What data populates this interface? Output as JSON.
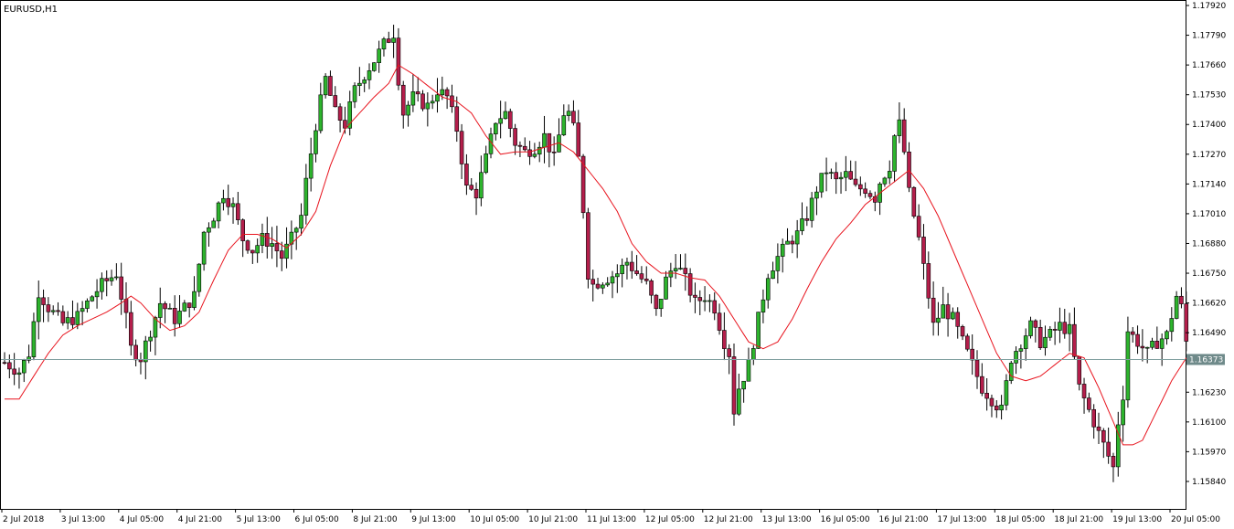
{
  "chart_data": {
    "type": "candlestick",
    "symbol": "EURUSD,H1",
    "y_ticks": [
      "1.17920",
      "1.17790",
      "1.17660",
      "1.17530",
      "1.17400",
      "1.17270",
      "1.17140",
      "1.17010",
      "1.16880",
      "1.16750",
      "1.16620",
      "1.16490",
      "1.16230",
      "1.16100",
      "1.15970",
      "1.15840"
    ],
    "ylim": [
      1.1572,
      1.1794
    ],
    "current_price": "1.16373",
    "current_price_value": 1.16373,
    "x_ticks": [
      "2 Jul 2018",
      "3 Jul 13:00",
      "4 Jul 05:00",
      "4 Jul 21:00",
      "5 Jul 13:00",
      "6 Jul 05:00",
      "8 Jul 21:00",
      "9 Jul 13:00",
      "10 Jul 05:00",
      "10 Jul 21:00",
      "11 Jul 13:00",
      "12 Jul 05:00",
      "12 Jul 21:00",
      "13 Jul 13:00",
      "16 Jul 05:00",
      "16 Jul 21:00",
      "17 Jul 13:00",
      "18 Jul 05:00",
      "18 Jul 21:00",
      "19 Jul 13:00",
      "20 Jul 05:00"
    ],
    "close_path": [
      [
        0,
        1.1636
      ],
      [
        3,
        1.1632
      ],
      [
        5,
        1.164
      ],
      [
        7,
        1.1667
      ],
      [
        9,
        1.166
      ],
      [
        12,
        1.1653
      ],
      [
        15,
        1.1656
      ],
      [
        18,
        1.1665
      ],
      [
        20,
        1.167
      ],
      [
        23,
        1.1675
      ],
      [
        25,
        1.1655
      ],
      [
        26,
        1.1642
      ],
      [
        28,
        1.1638
      ],
      [
        30,
        1.165
      ],
      [
        32,
        1.1662
      ],
      [
        35,
        1.1655
      ],
      [
        37,
        1.166
      ],
      [
        39,
        1.1665
      ],
      [
        41,
        1.1693
      ],
      [
        43,
        1.17
      ],
      [
        45,
        1.171
      ],
      [
        47,
        1.1704
      ],
      [
        49,
        1.169
      ],
      [
        51,
        1.1685
      ],
      [
        53,
        1.169
      ],
      [
        55,
        1.1688
      ],
      [
        57,
        1.1682
      ],
      [
        59,
        1.169
      ],
      [
        61,
        1.17
      ],
      [
        62,
        1.1715
      ],
      [
        64,
        1.174
      ],
      [
        66,
        1.176
      ],
      [
        68,
        1.1745
      ],
      [
        70,
        1.174
      ],
      [
        72,
        1.1755
      ],
      [
        74,
        1.1762
      ],
      [
        76,
        1.1768
      ],
      [
        78,
        1.1775
      ],
      [
        80,
        1.178
      ],
      [
        81,
        1.176
      ],
      [
        82,
        1.1745
      ],
      [
        84,
        1.1752
      ],
      [
        87,
        1.1748
      ],
      [
        89,
        1.1755
      ],
      [
        91,
        1.1752
      ],
      [
        93,
        1.1738
      ],
      [
        95,
        1.1712
      ],
      [
        97,
        1.171
      ],
      [
        99,
        1.1725
      ],
      [
        101,
        1.1742
      ],
      [
        103,
        1.1745
      ],
      [
        105,
        1.1732
      ],
      [
        107,
        1.1728
      ],
      [
        109,
        1.173
      ],
      [
        111,
        1.1735
      ],
      [
        113,
        1.1725
      ],
      [
        115,
        1.1745
      ],
      [
        116,
        1.1745
      ],
      [
        117,
        1.1738
      ],
      [
        118,
        1.1725
      ],
      [
        119,
        1.1703
      ],
      [
        120,
        1.1675
      ],
      [
        121,
        1.167
      ],
      [
        123,
        1.1672
      ],
      [
        126,
        1.1675
      ],
      [
        128,
        1.168
      ],
      [
        130,
        1.1675
      ],
      [
        132,
        1.167
      ],
      [
        134,
        1.1658
      ],
      [
        136,
        1.1672
      ],
      [
        138,
        1.168
      ],
      [
        140,
        1.1672
      ],
      [
        142,
        1.1662
      ],
      [
        144,
        1.1665
      ],
      [
        146,
        1.166
      ],
      [
        148,
        1.1645
      ],
      [
        149,
        1.164
      ],
      [
        150,
        1.1615
      ],
      [
        151,
        1.1625
      ],
      [
        153,
        1.1635
      ],
      [
        155,
        1.1655
      ],
      [
        157,
        1.1675
      ],
      [
        159,
        1.1682
      ],
      [
        161,
        1.1688
      ],
      [
        163,
        1.1692
      ],
      [
        165,
        1.17
      ],
      [
        167,
        1.1712
      ],
      [
        169,
        1.172
      ],
      [
        171,
        1.1715
      ],
      [
        173,
        1.1718
      ],
      [
        175,
        1.1712
      ],
      [
        177,
        1.1712
      ],
      [
        179,
        1.1708
      ],
      [
        180,
        1.1715
      ],
      [
        182,
        1.1722
      ],
      [
        183,
        1.1735
      ],
      [
        184,
        1.174
      ],
      [
        185,
        1.1728
      ],
      [
        186,
        1.171
      ],
      [
        188,
        1.169
      ],
      [
        190,
        1.1665
      ],
      [
        191,
        1.1652
      ],
      [
        193,
        1.166
      ],
      [
        195,
        1.1655
      ],
      [
        197,
        1.1645
      ],
      [
        199,
        1.1635
      ],
      [
        201,
        1.1625
      ],
      [
        203,
        1.162
      ],
      [
        205,
        1.1615
      ],
      [
        207,
        1.1638
      ],
      [
        209,
        1.1645
      ],
      [
        211,
        1.1652
      ],
      [
        213,
        1.1645
      ],
      [
        215,
        1.1648
      ],
      [
        217,
        1.1652
      ],
      [
        219,
        1.165
      ],
      [
        221,
        1.1625
      ],
      [
        223,
        1.1615
      ],
      [
        225,
        1.1605
      ],
      [
        227,
        1.1595
      ],
      [
        228,
        1.159
      ],
      [
        229,
        1.161
      ],
      [
        230,
        1.1622
      ],
      [
        231,
        1.165
      ],
      [
        233,
        1.1645
      ],
      [
        235,
        1.164
      ],
      [
        237,
        1.1645
      ],
      [
        239,
        1.1648
      ],
      [
        241,
        1.1665
      ],
      [
        242,
        1.166
      ],
      [
        243,
        1.1645
      ]
    ],
    "ma_path": [
      [
        0,
        1.162
      ],
      [
        3,
        1.162
      ],
      [
        6,
        1.163
      ],
      [
        9,
        1.164
      ],
      [
        12,
        1.1648
      ],
      [
        15,
        1.1652
      ],
      [
        18,
        1.1655
      ],
      [
        21,
        1.1658
      ],
      [
        24,
        1.1662
      ],
      [
        26,
        1.1665
      ],
      [
        28,
        1.1662
      ],
      [
        31,
        1.1655
      ],
      [
        34,
        1.165
      ],
      [
        37,
        1.1652
      ],
      [
        40,
        1.1658
      ],
      [
        43,
        1.1672
      ],
      [
        46,
        1.1685
      ],
      [
        49,
        1.1692
      ],
      [
        52,
        1.1692
      ],
      [
        55,
        1.169
      ],
      [
        58,
        1.1686
      ],
      [
        61,
        1.1692
      ],
      [
        64,
        1.1702
      ],
      [
        67,
        1.1722
      ],
      [
        70,
        1.1738
      ],
      [
        73,
        1.1745
      ],
      [
        76,
        1.1752
      ],
      [
        79,
        1.1758
      ],
      [
        81,
        1.1766
      ],
      [
        84,
        1.1762
      ],
      [
        87,
        1.1757
      ],
      [
        90,
        1.1752
      ],
      [
        93,
        1.175
      ],
      [
        96,
        1.1745
      ],
      [
        99,
        1.1735
      ],
      [
        102,
        1.1727
      ],
      [
        105,
        1.1728
      ],
      [
        108,
        1.1728
      ],
      [
        111,
        1.173
      ],
      [
        114,
        1.1732
      ],
      [
        117,
        1.1728
      ],
      [
        120,
        1.172
      ],
      [
        123,
        1.1712
      ],
      [
        126,
        1.1702
      ],
      [
        129,
        1.1688
      ],
      [
        132,
        1.168
      ],
      [
        135,
        1.1675
      ],
      [
        138,
        1.1675
      ],
      [
        141,
        1.1673
      ],
      [
        144,
        1.1672
      ],
      [
        147,
        1.1665
      ],
      [
        150,
        1.1655
      ],
      [
        153,
        1.1645
      ],
      [
        156,
        1.1642
      ],
      [
        159,
        1.1645
      ],
      [
        162,
        1.1655
      ],
      [
        165,
        1.1668
      ],
      [
        168,
        1.168
      ],
      [
        171,
        1.169
      ],
      [
        174,
        1.1697
      ],
      [
        177,
        1.1705
      ],
      [
        180,
        1.171
      ],
      [
        183,
        1.1715
      ],
      [
        186,
        1.172
      ],
      [
        189,
        1.1712
      ],
      [
        192,
        1.17
      ],
      [
        195,
        1.1685
      ],
      [
        198,
        1.167
      ],
      [
        201,
        1.1655
      ],
      [
        204,
        1.164
      ],
      [
        207,
        1.163
      ],
      [
        210,
        1.1628
      ],
      [
        213,
        1.163
      ],
      [
        216,
        1.1635
      ],
      [
        219,
        1.164
      ],
      [
        222,
        1.1638
      ],
      [
        225,
        1.1625
      ],
      [
        228,
        1.161
      ],
      [
        230,
        1.16
      ],
      [
        232,
        1.16
      ],
      [
        234,
        1.1602
      ],
      [
        237,
        1.1615
      ],
      [
        240,
        1.1628
      ],
      [
        243,
        1.1638
      ]
    ],
    "bar_count": 244,
    "colors": {
      "background": "#ffffff",
      "axis": "#000000",
      "bull_body": "#2db42d",
      "bear_body": "#b41e4b",
      "wick": "#000000",
      "ma_line": "#e8141e",
      "price_line": "#7f9f9f",
      "price_box": "#6f8a8a"
    }
  }
}
